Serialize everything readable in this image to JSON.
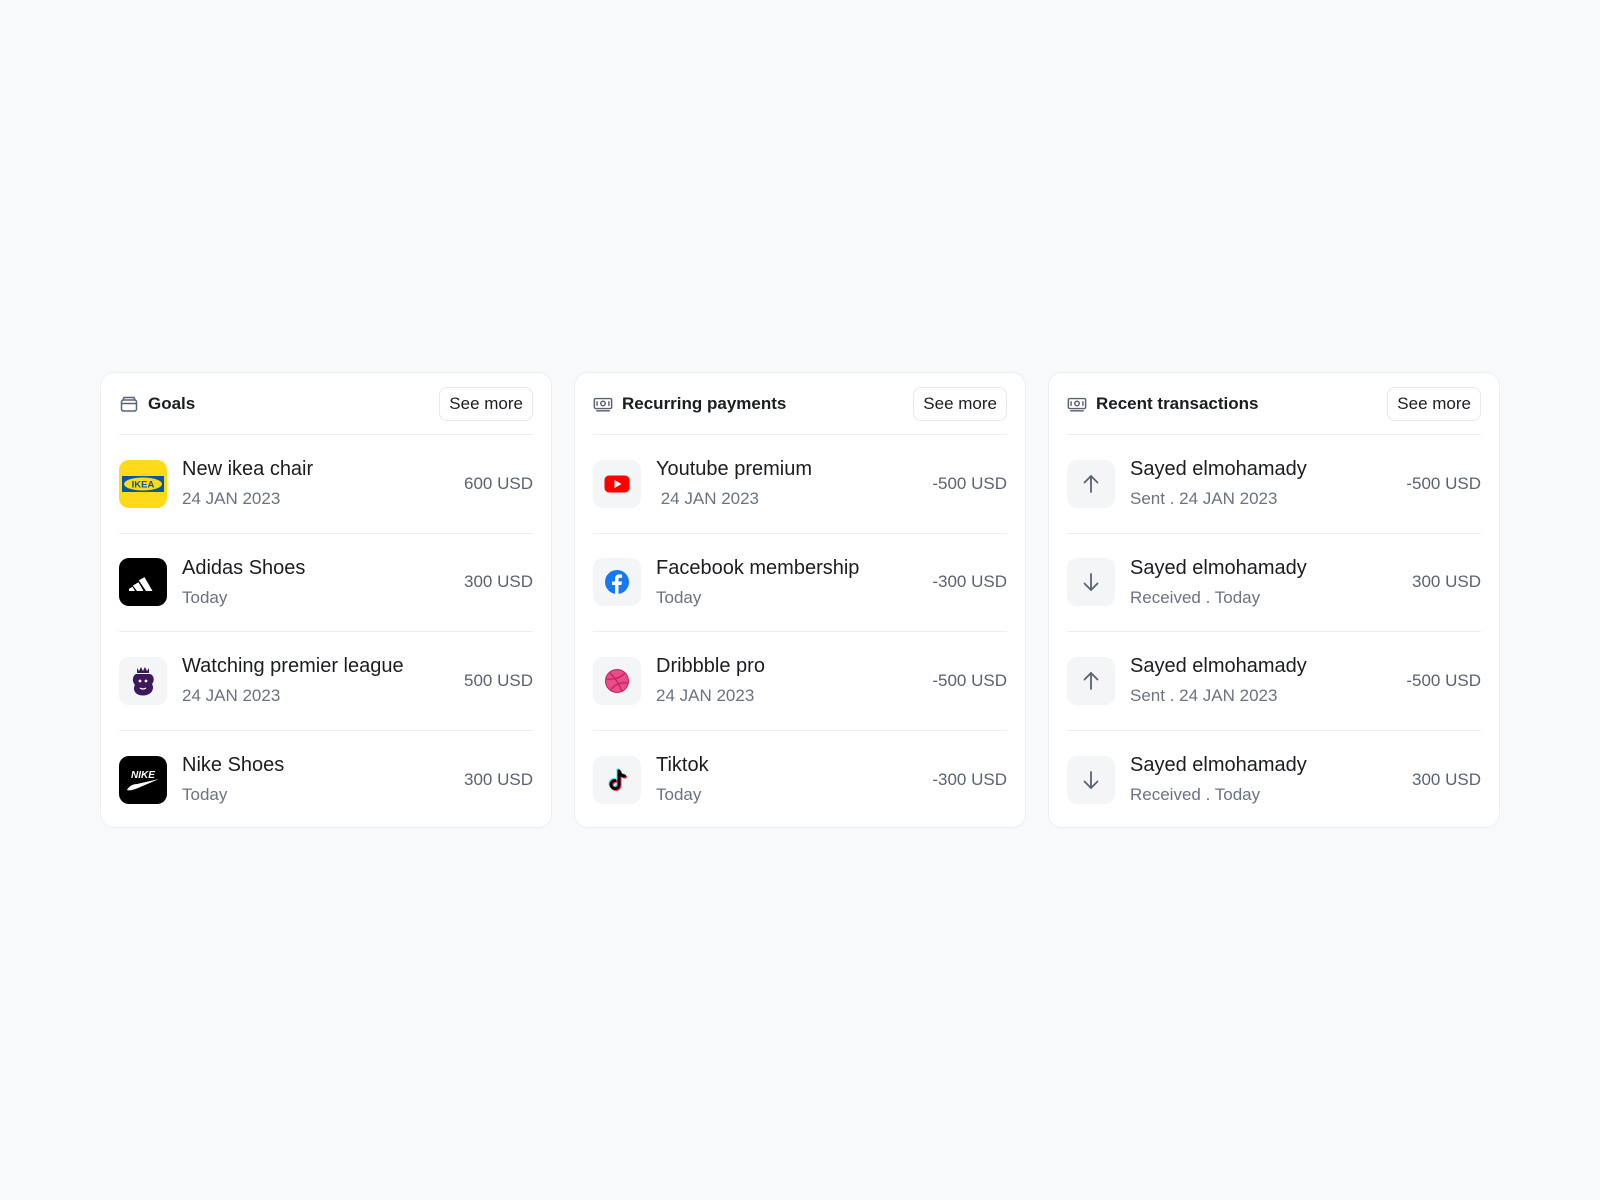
{
  "goals": {
    "title": "Goals",
    "see_more": "See more",
    "icon": "wallet-icon",
    "items": [
      {
        "name": "New ikea chair",
        "sub": "24 JAN 2023",
        "amount": "600 USD",
        "logo": "ikea-logo",
        "logo_text": "IKEA"
      },
      {
        "name": "Adidas Shoes",
        "sub": "Today",
        "amount": "300 USD",
        "logo": "adidas-logo"
      },
      {
        "name": "Watching premier league",
        "sub": "24 JAN 2023",
        "amount": "500 USD",
        "logo": "premier-league-logo"
      },
      {
        "name": "Nike Shoes",
        "sub": "Today",
        "amount": "300 USD",
        "logo": "nike-logo",
        "logo_text": "NIKE"
      }
    ]
  },
  "recurring": {
    "title": "Recurring payments",
    "see_more": "See more",
    "icon": "money-icon",
    "items": [
      {
        "name": "Youtube premium",
        "sub": " 24 JAN 2023",
        "amount": "-500 USD",
        "logo": "youtube-logo"
      },
      {
        "name": "Facebook membership",
        "sub": "Today",
        "amount": "-300 USD",
        "logo": "facebook-logo"
      },
      {
        "name": "Dribbble pro",
        "sub": "24 JAN 2023",
        "amount": "-500 USD",
        "logo": "dribbble-logo"
      },
      {
        "name": "Tiktok",
        "sub": "Today",
        "amount": "-300 USD",
        "logo": "tiktok-logo"
      }
    ]
  },
  "recent": {
    "title": "Recent transactions",
    "see_more": "See more",
    "icon": "money-icon",
    "items": [
      {
        "name": "Sayed elmohamady",
        "sub": "Sent . 24 JAN 2023",
        "amount": "-500 USD",
        "logo": "arrow-up-icon"
      },
      {
        "name": "Sayed elmohamady",
        "sub": "Received . Today",
        "amount": "300 USD",
        "logo": "arrow-down-icon"
      },
      {
        "name": "Sayed elmohamady",
        "sub": "Sent . 24 JAN 2023",
        "amount": "-500 USD",
        "logo": "arrow-up-icon"
      },
      {
        "name": "Sayed elmohamady",
        "sub": "Received . Today",
        "amount": "300 USD",
        "logo": "arrow-down-icon"
      }
    ]
  },
  "colors": {
    "background": "#f8f9fb",
    "card": "#ffffff",
    "border": "#eceef2",
    "ikea_yellow": "#ffda1a",
    "ikea_blue": "#0058a3",
    "youtube_red": "#ff0000",
    "facebook_blue": "#1877f2",
    "dribbble_pink": "#ea4c89",
    "premier_purple": "#3d195b"
  }
}
